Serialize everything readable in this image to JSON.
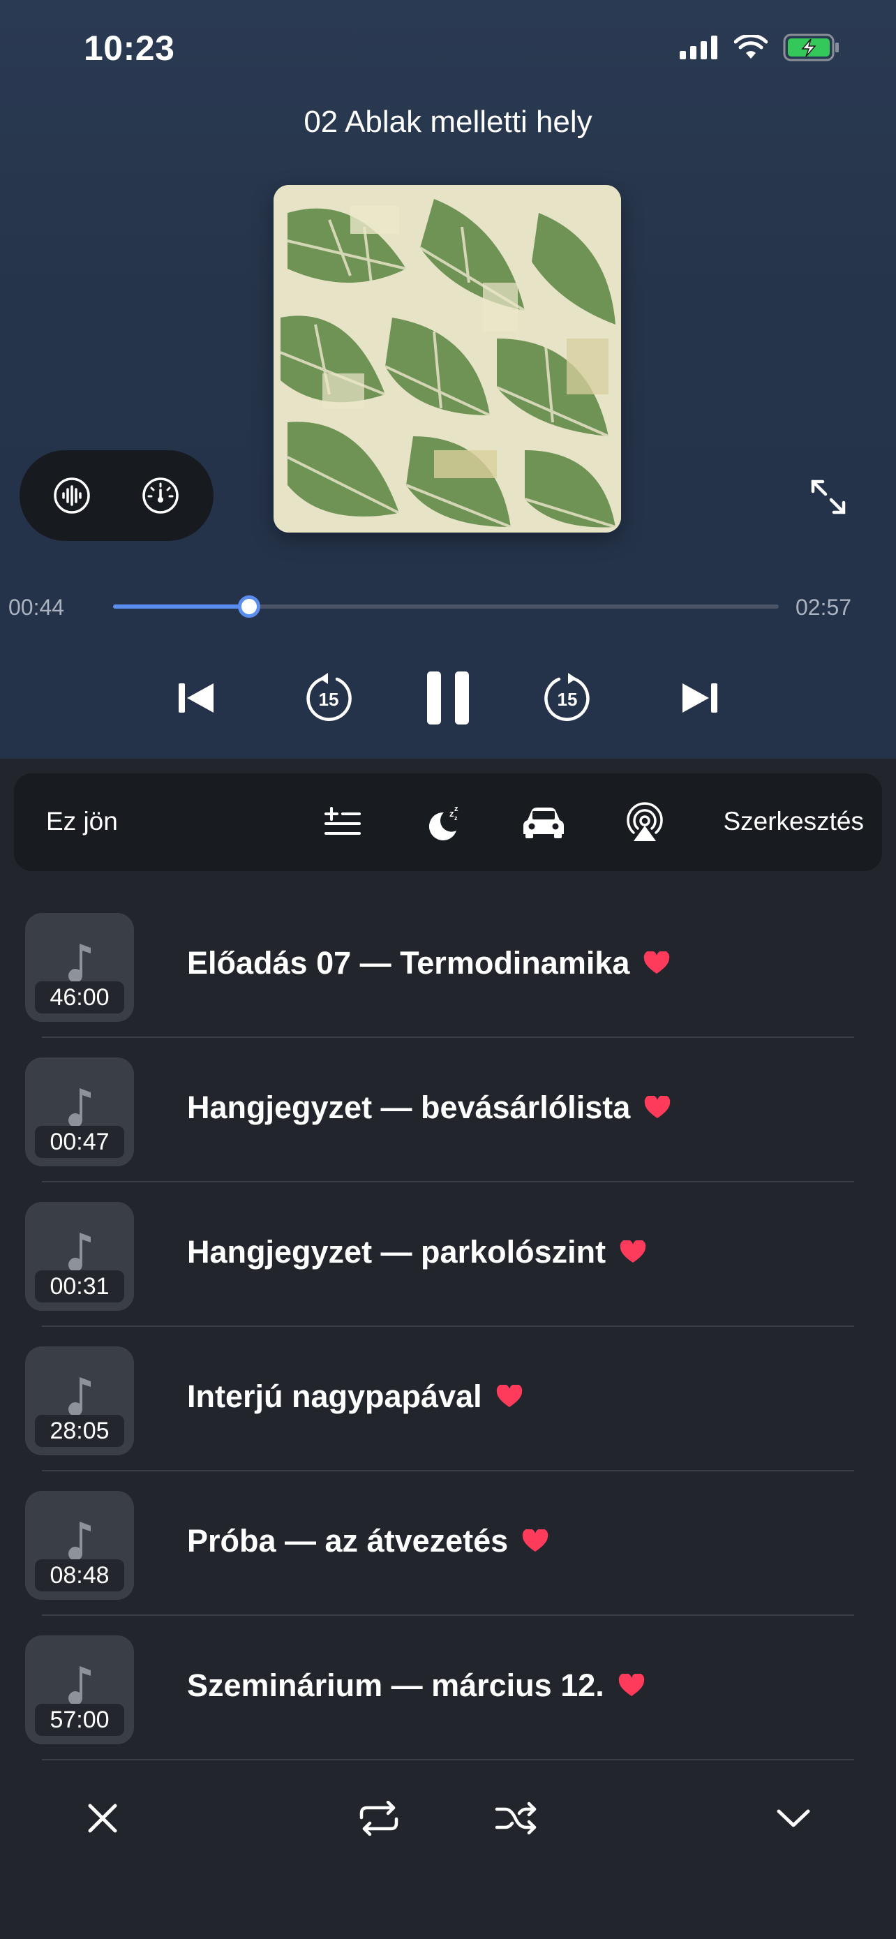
{
  "status": {
    "time": "10:23"
  },
  "player": {
    "title": "02 Ablak melletti hely",
    "elapsed": "00:44",
    "total": "02:57",
    "progress_fraction": 0.204,
    "skip_back_seconds": "15",
    "skip_forward_seconds": "15"
  },
  "toolbar": {
    "up_next_label": "Ez jön",
    "edit_label": "Szerkesztés"
  },
  "queue": [
    {
      "title": "Előadás 07 — Termodinamika",
      "duration": "46:00",
      "favorite": true
    },
    {
      "title": "Hangjegyzet — bevásárlólista",
      "duration": "00:47",
      "favorite": true
    },
    {
      "title": "Hangjegyzet — parkolószint",
      "duration": "00:31",
      "favorite": true
    },
    {
      "title": "Interjú nagypapával",
      "duration": "28:05",
      "favorite": true
    },
    {
      "title": "Próba — az átvezetés",
      "duration": "08:48",
      "favorite": true
    },
    {
      "title": "Szeminárium — március 12.",
      "duration": "57:00",
      "favorite": true
    }
  ],
  "colors": {
    "accent": "#5b8dee",
    "heart": "#ff3b5c",
    "battery": "#34c759"
  }
}
